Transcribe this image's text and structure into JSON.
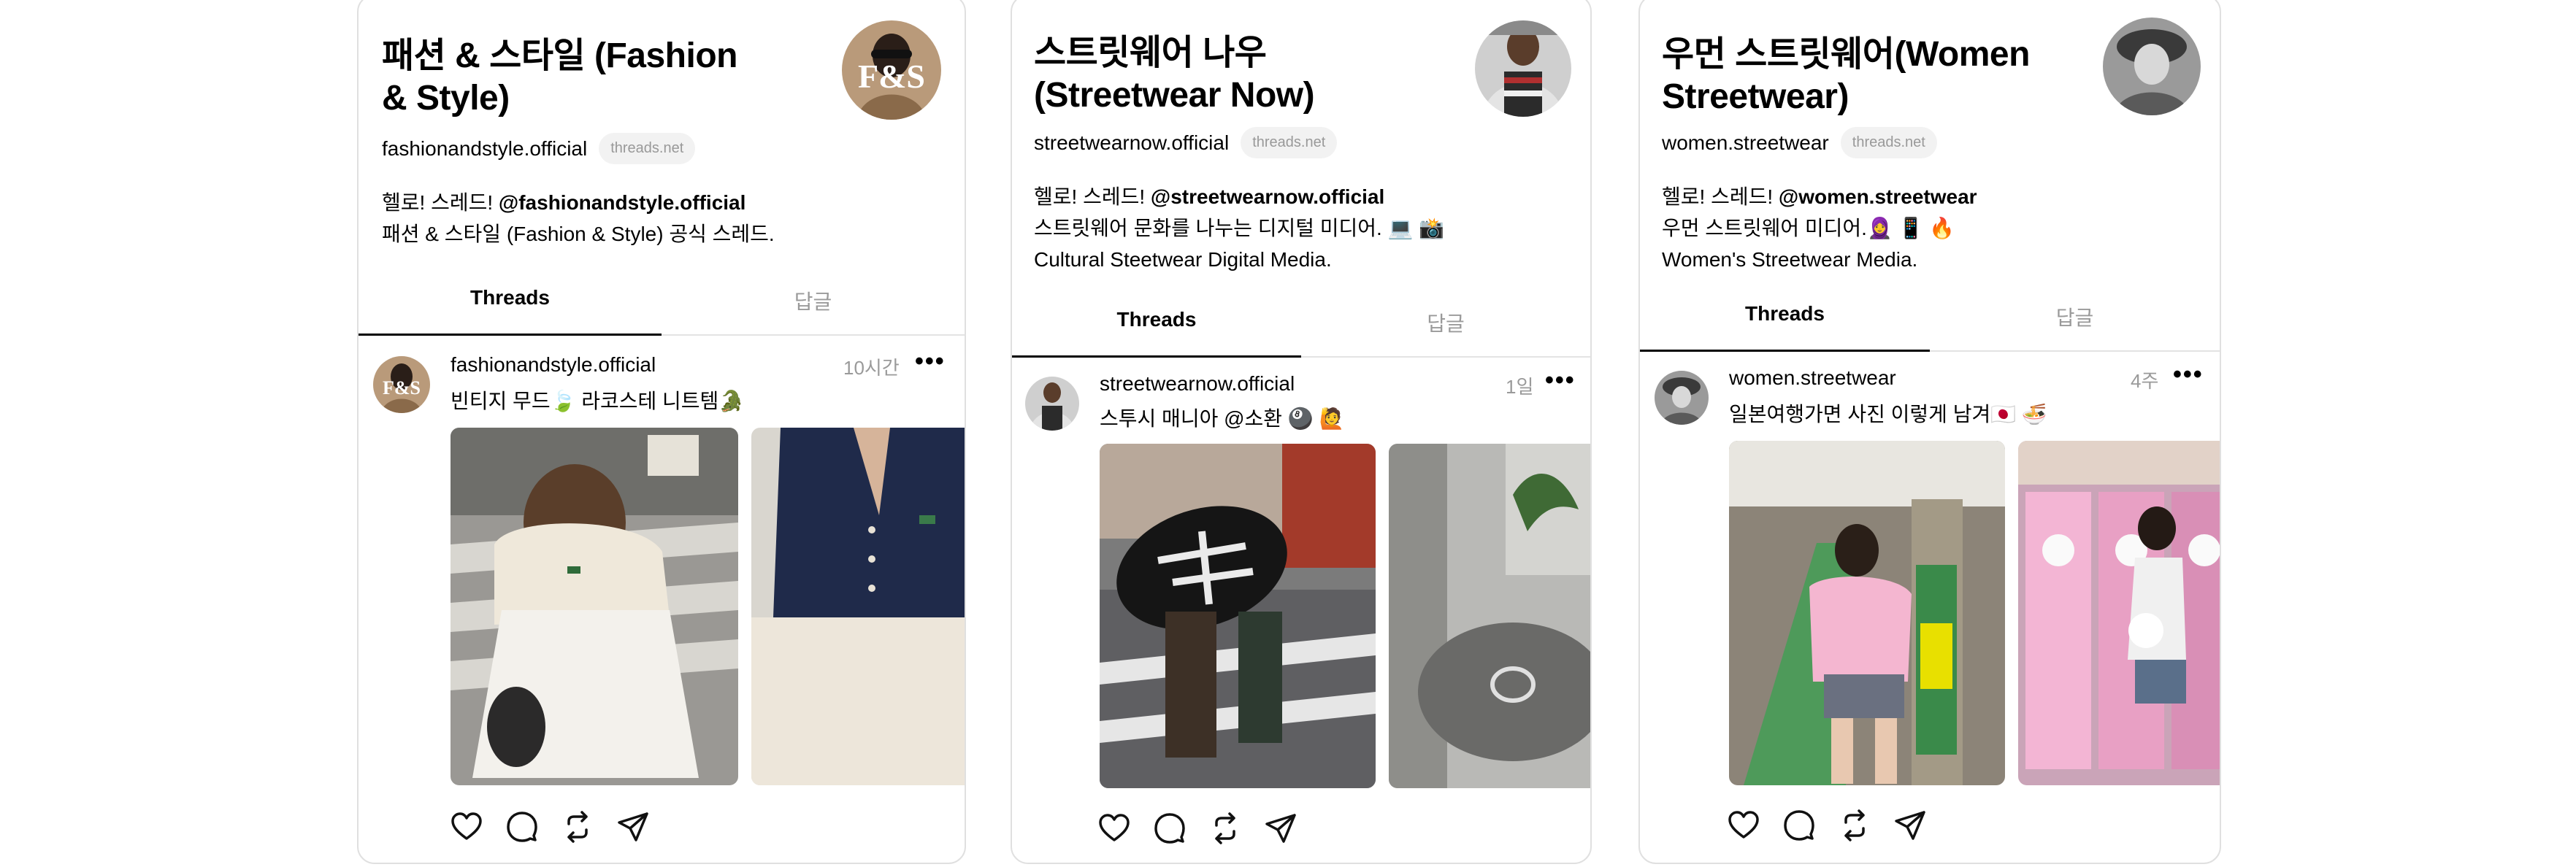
{
  "cards": [
    {
      "title": "패션 & 스타일 (Fashion\n& Style)",
      "handle": "fashionandstyle.official",
      "domain": "threads.net",
      "bio": {
        "line1_prefix": "헬로! 스레드! ",
        "line1_bold": "@fashionandstyle.official",
        "line2": "패션 & 스타일 (Fashion & Style) 공식 스레드.",
        "line3": ""
      },
      "avatar_text": "F&S",
      "tabs": [
        "Threads",
        "답글"
      ],
      "post": {
        "user": "fashionandstyle.official",
        "time": "10시간",
        "more": "•••",
        "caption": "빈티지 무드🍃 라코스테 니트템🐊"
      }
    },
    {
      "title": "스트릿웨어 나우\n(Streetwear Now)",
      "handle": "streetwearnow.official",
      "domain": "threads.net",
      "bio": {
        "line1_prefix": "헬로! 스레드! ",
        "line1_bold": "@streetwearnow.official",
        "line2": "스트릿웨어 문화를 나누는 디지털 미디어. 💻 📸",
        "line3": "Cultural Steetwear Digital Media."
      },
      "avatar_text": "",
      "tabs": [
        "Threads",
        "답글"
      ],
      "post": {
        "user": "streetwearnow.official",
        "time": "1일",
        "more": "•••",
        "caption": "스투시 매니아 @소환 🎱 🙋"
      }
    },
    {
      "title": "우먼 스트릿웨어(Women\nStreetwear)",
      "handle": "women.streetwear",
      "domain": "threads.net",
      "bio": {
        "line1_prefix": "헬로! 스레드! ",
        "line1_bold": "@women.streetwear",
        "line2": "우먼 스트릿웨어 미디어.🧕 📱 🔥",
        "line3": "Women's Streetwear Media."
      },
      "avatar_text": "",
      "tabs": [
        "Threads",
        "답글"
      ],
      "post": {
        "user": "women.streetwear",
        "time": "4주",
        "more": "•••",
        "caption": "일본여행가면 사진 이렇게 남겨🇯🇵 🍜"
      }
    }
  ],
  "actions": [
    "heart-icon",
    "comment-icon",
    "repost-icon",
    "share-icon"
  ],
  "colors": {
    "border": "#e0e0e0",
    "muted": "#9a9a9a",
    "pill_bg": "#f2f2f2",
    "text": "#000000"
  }
}
